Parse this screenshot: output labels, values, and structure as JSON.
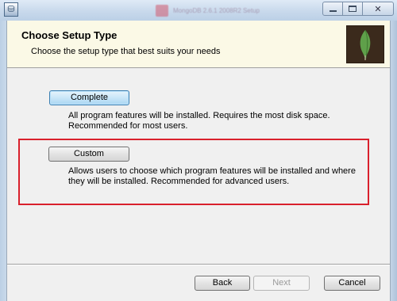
{
  "window": {
    "icon_glyph": "⛁",
    "blurred_title": "MongoDB 2.6.1 2008R2 Setup",
    "controls": {
      "minimize": "minimize-icon",
      "maximize": "maximize-icon",
      "close": "✕"
    }
  },
  "banner": {
    "title": "Choose Setup Type",
    "subtitle": "Choose the setup type that best suits your needs",
    "logo": "mongodb-leaf-icon"
  },
  "options": [
    {
      "button_label": "Complete",
      "description": "All program features will be installed. Requires the most disk space. Recommended for most users."
    },
    {
      "button_label": "Custom",
      "description": "Allows users to choose which program features will be installed and where they will be installed. Recommended for advanced users."
    }
  ],
  "footer": {
    "back_label": "Back",
    "next_label": "Next",
    "cancel_label": "Cancel"
  },
  "colors": {
    "banner_bg": "#fbf9e6",
    "highlight": "#d9202c",
    "logo_bg": "#3b2a1c",
    "leaf": "#5fa04a"
  }
}
